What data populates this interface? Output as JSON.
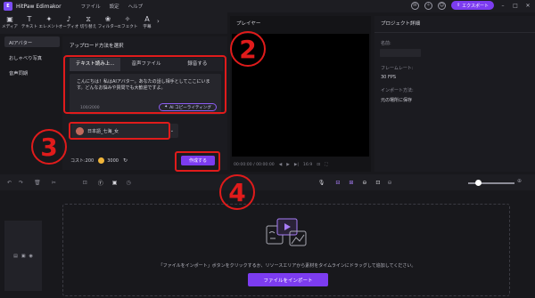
{
  "app": {
    "title": "HitPaw Edimakor",
    "logo": "E"
  },
  "menu": [
    "ファイル",
    "設定",
    "ヘルプ"
  ],
  "titlebar": {
    "export_label": "エクスポート"
  },
  "toolbar": [
    {
      "icon": "media-icon",
      "label": "メディア",
      "glyph": "▣"
    },
    {
      "icon": "text-icon",
      "label": "テキスト",
      "glyph": "T"
    },
    {
      "icon": "element-icon",
      "label": "エレメント",
      "glyph": "✦"
    },
    {
      "icon": "audio-icon",
      "label": "オーディオ",
      "glyph": "♪"
    },
    {
      "icon": "transition-icon",
      "label": "切り替え",
      "glyph": "⧖"
    },
    {
      "icon": "filter-icon",
      "label": "フィルター",
      "glyph": "❀"
    },
    {
      "icon": "effect-icon",
      "label": "エフェクト",
      "glyph": "✧"
    },
    {
      "icon": "subtitle-icon",
      "label": "字幕",
      "glyph": "A"
    }
  ],
  "sidebar": {
    "items": [
      {
        "label": "AIアバター",
        "active": true
      },
      {
        "label": "おしゃべり写真",
        "active": false
      },
      {
        "label": "音声同期",
        "active": false
      }
    ]
  },
  "ai_panel": {
    "title": "アップロード方法を選択",
    "tabs": [
      "テキスト読み上...",
      "音声ファイル",
      "録音する"
    ],
    "text": "こんにちは！私はAIアバター。あなたの話し相手としてここにいます。どんなお悩みや質問でも大歓迎ですよ。",
    "counter": "100/2000",
    "ai_write_label": "AI コピーライティング",
    "voice": "日本語_七海_女",
    "cost_label": "コスト:200",
    "coin_value": "3000",
    "create_label": "作成する"
  },
  "player": {
    "title": "プレイヤー",
    "time": "00:00:00 / 00:00:00",
    "ratio": "16:9"
  },
  "project": {
    "title": "プロジェクト詳細",
    "name_label": "名前:",
    "fps_label": "フレームレート:",
    "fps_value": "30 FPS",
    "import_label": "インポート方法:",
    "import_value": "元の場所に保存"
  },
  "timeline": {
    "drop_text": "「ファイルをインポート」ボタンをクリックするか、リソースエリアから素材をタイムラインにドラッグして追加してください。",
    "import_button": "ファイルをインポート"
  },
  "annotations": [
    "2",
    "3",
    "4"
  ],
  "colors": {
    "accent": "#7c3cf0",
    "annotation": "#e01b1b"
  }
}
